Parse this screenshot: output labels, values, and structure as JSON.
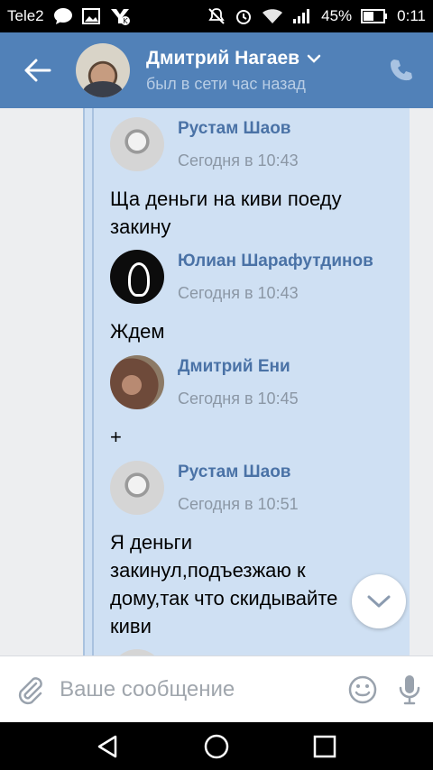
{
  "status_bar": {
    "carrier": "Tele2",
    "battery": "45%",
    "time": "0:11",
    "icons": [
      "chat-bubble-icon",
      "image-icon",
      "vk-icon",
      "mute-icon",
      "alarm-icon",
      "wifi-icon",
      "signal-icon",
      "battery-icon"
    ]
  },
  "header": {
    "name": "Дмитрий Нагаев",
    "status": "был в сети час назад"
  },
  "messages": [
    {
      "author": "Рустам Шаов",
      "time": "Сегодня в 10:43",
      "text": "Ща деньги на киви поеду закину"
    },
    {
      "author": "Юлиан Шарафутдинов",
      "time": "Сегодня в 10:43",
      "text": "Ждем"
    },
    {
      "author": "Дмитрий Ени",
      "time": "Сегодня в 10:45",
      "text": "+"
    },
    {
      "author": "Рустам Шаов",
      "time": "Сегодня в 10:51",
      "text": "Я деньги закинул,подъезжаю к дому,так что скидывайте киви"
    }
  ],
  "compose": {
    "placeholder": "Ваше сообщение"
  },
  "colors": {
    "header_bg": "#5181b8",
    "bubble_bg": "#cfe0f3",
    "author_link": "#4a72a6"
  }
}
